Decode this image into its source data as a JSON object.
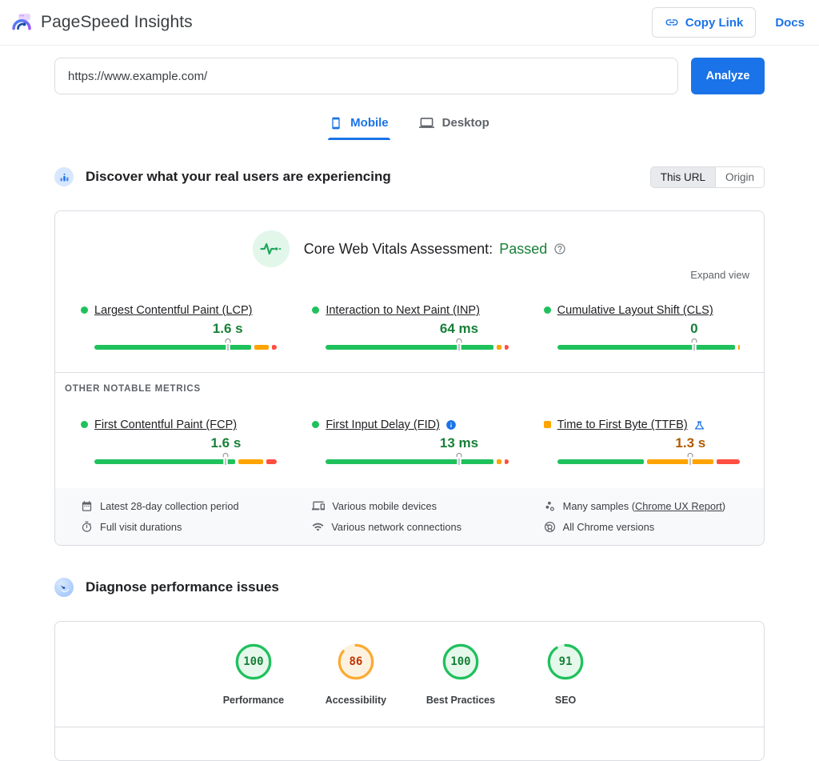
{
  "header": {
    "title": "PageSpeed Insights",
    "copy_link": "Copy Link",
    "docs": "Docs"
  },
  "url_bar": {
    "value": "https://www.example.com/",
    "analyze": "Analyze"
  },
  "tabs": {
    "mobile": "Mobile",
    "desktop": "Desktop",
    "active": "Mobile"
  },
  "field_section": {
    "heading": "Discover what your real users are experiencing",
    "scope_toggle": {
      "this_url": "This URL",
      "origin": "Origin",
      "selected": "This URL"
    },
    "assessment": {
      "prefix": "Core Web Vitals Assessment:",
      "status": "Passed"
    },
    "expand_view": "Expand view",
    "other_metrics_heading": "OTHER NOTABLE METRICS",
    "core_metrics": [
      {
        "name": "Largest Contentful Paint (LCP)",
        "value": "1.6 s",
        "rating": "good",
        "marker_pct": 73,
        "distribution_pct": {
          "good": 89,
          "needs_improvement": 8,
          "poor": 3
        }
      },
      {
        "name": "Interaction to Next Paint (INP)",
        "value": "64 ms",
        "rating": "good",
        "marker_pct": 73,
        "distribution_pct": {
          "good": 95,
          "needs_improvement": 3,
          "poor": 2
        }
      },
      {
        "name": "Cumulative Layout Shift (CLS)",
        "value": "0",
        "rating": "good",
        "marker_pct": 75,
        "distribution_pct": {
          "good": 99,
          "needs_improvement": 1,
          "poor": 0
        }
      }
    ],
    "other_metrics": [
      {
        "name": "First Contentful Paint (FCP)",
        "value": "1.6 s",
        "rating": "good",
        "marker_pct": 72,
        "distribution_pct": {
          "good": 80,
          "needs_improvement": 14,
          "poor": 6
        }
      },
      {
        "name": "First Input Delay (FID)",
        "value": "13 ms",
        "rating": "good",
        "marker_pct": 73,
        "info_icon": true,
        "distribution_pct": {
          "good": 95,
          "needs_improvement": 3,
          "poor": 2
        }
      },
      {
        "name": "Time to First Byte (TTFB)",
        "value": "1.3 s",
        "rating": "average",
        "marker_pct": 73,
        "experimental_icon": true,
        "distribution_pct": {
          "good": 49,
          "needs_improvement": 38,
          "poor": 13
        }
      }
    ],
    "collection_details": [
      {
        "icon": "calendar",
        "text": "Latest 28-day collection period"
      },
      {
        "icon": "devices",
        "text": "Various mobile devices"
      },
      {
        "icon": "samples",
        "text": "Many samples (",
        "link": "Chrome UX Report",
        "suffix": ")"
      },
      {
        "icon": "stopwatch",
        "text": "Full visit durations"
      },
      {
        "icon": "wifi",
        "text": "Various network connections"
      },
      {
        "icon": "chrome",
        "text": "All Chrome versions"
      }
    ]
  },
  "lab_section": {
    "heading": "Diagnose performance issues",
    "categories": [
      {
        "label": "Performance",
        "score": 100,
        "rating": "good"
      },
      {
        "label": "Accessibility",
        "score": 86,
        "rating": "average"
      },
      {
        "label": "Best Practices",
        "score": 100,
        "rating": "good"
      },
      {
        "label": "SEO",
        "score": 91,
        "rating": "good"
      }
    ]
  },
  "colors": {
    "accent_blue": "#1a73e8",
    "good_green": "#1fc15c",
    "average_orange": "#ffa400",
    "poor_red": "#ff4e42",
    "passed_text": "#188038",
    "average_value_text": "#b05a00",
    "average_score_text": "#c33300"
  }
}
